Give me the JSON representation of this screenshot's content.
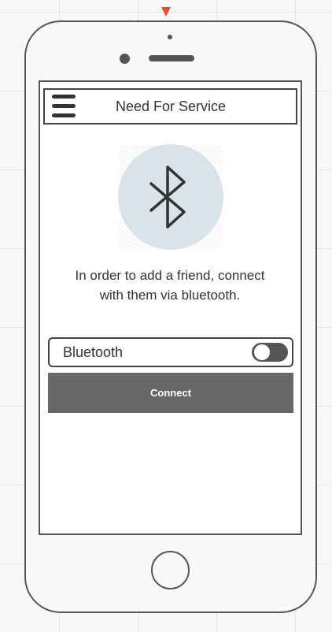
{
  "header": {
    "title": "Need For Service",
    "menu_icon": "hamburger-menu-icon"
  },
  "hero": {
    "icon": "bluetooth-icon",
    "circle_color": "#d9e4e8"
  },
  "instructions": {
    "line1": "In order to add a friend, connect",
    "line2": "with them via bluetooth."
  },
  "bluetooth_toggle": {
    "label": "Bluetooth",
    "enabled": false
  },
  "connect_button": {
    "label": "Connect",
    "color": "#676767"
  },
  "colors": {
    "phone_outline": "#555555",
    "marker": "#ea4a2f"
  }
}
